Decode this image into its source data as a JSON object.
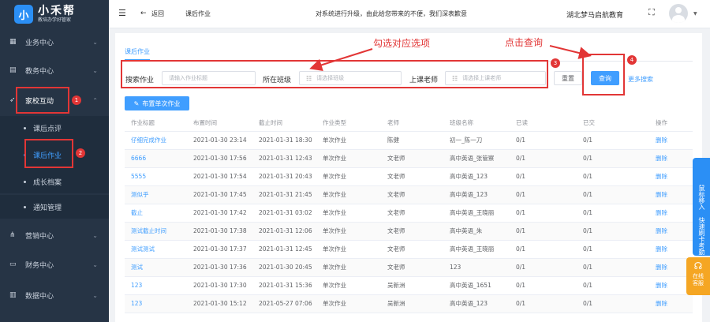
{
  "sidebar": {
    "logo_glyph": "小",
    "logo_name": "小禾帮",
    "logo_sub": "教培办学好管家",
    "menus": [
      {
        "label": "业务中心",
        "icon": "grid-icon"
      },
      {
        "label": "教务中心",
        "icon": "book-icon"
      },
      {
        "label": "家校互动",
        "icon": "send-icon"
      },
      {
        "label": "营销中心",
        "icon": "share-icon"
      },
      {
        "label": "财务中心",
        "icon": "wallet-icon"
      },
      {
        "label": "数据中心",
        "icon": "chart-icon"
      }
    ],
    "sub_items": [
      "课后点评",
      "课后作业",
      "成长档案",
      "通知管理"
    ]
  },
  "topbar": {
    "back": "返回",
    "page": "课后作业",
    "notice": "对系统进行升级，由此给您带来的不便，我们深表歉意",
    "org": "湖北梦马启航教育"
  },
  "tabs": {
    "active": "课后作业"
  },
  "filters": {
    "homework_label": "搜索作业",
    "homework_placeholder": "请输入作业标题",
    "class_label": "所在班级",
    "class_placeholder": "请选择班级",
    "teacher_label": "上课老师",
    "teacher_placeholder": "请选择上课老师",
    "reset": "重置",
    "search": "查询",
    "more": "更多搜索"
  },
  "toolbar": {
    "assign": "布置单次作业"
  },
  "annotations": {
    "a1": "勾选对应选项",
    "a2": "点击查询",
    "n1": "1",
    "n2": "2",
    "n3": "3",
    "n4": "4"
  },
  "table": {
    "headers": [
      "作业标题",
      "布置时间",
      "截止时间",
      "作业类型",
      "老师",
      "班级名称",
      "已读",
      "已交",
      "操作"
    ],
    "rows": [
      [
        "仔细完成作业",
        "2021-01-30 23:14",
        "2021-01-31 18:30",
        "单次作业",
        "陈健",
        "初一_陈一刀",
        "0/1",
        "0/1",
        "删除"
      ],
      [
        "6666",
        "2021-01-30 17:56",
        "2021-01-31 12:43",
        "单次作业",
        "文老师",
        "高中英语_张管察",
        "0/1",
        "0/1",
        "删除"
      ],
      [
        "5555",
        "2021-01-30 17:54",
        "2021-01-31 20:43",
        "单次作业",
        "文老师",
        "高中英语_123",
        "0/1",
        "0/1",
        "删除"
      ],
      [
        "测似乎",
        "2021-01-30 17:45",
        "2021-01-31 21:45",
        "单次作业",
        "文老师",
        "高中英语_123",
        "0/1",
        "0/1",
        "删除"
      ],
      [
        "截止",
        "2021-01-30 17:42",
        "2021-01-31 03:02",
        "单次作业",
        "文老师",
        "高中英语_王晓丽",
        "0/1",
        "0/1",
        "删除"
      ],
      [
        "测试截止时间",
        "2021-01-30 17:38",
        "2021-01-31 12:06",
        "单次作业",
        "文老师",
        "高中英语_朱",
        "0/1",
        "0/1",
        "删除"
      ],
      [
        "测试测试",
        "2021-01-30 17:37",
        "2021-01-31 12:45",
        "单次作业",
        "文老师",
        "高中英语_王晓丽",
        "0/1",
        "0/1",
        "删除"
      ],
      [
        "测试",
        "2021-01-30 17:36",
        "2021-01-30 20:45",
        "单次作业",
        "文老师",
        "123",
        "0/1",
        "0/1",
        "删除"
      ],
      [
        "123",
        "2021-01-30 17:30",
        "2021-01-31 15:36",
        "单次作业",
        "吴新洲",
        "高中英语_1651",
        "0/1",
        "0/1",
        "删除"
      ],
      [
        "123",
        "2021-01-30 15:12",
        "2021-05-27 07:06",
        "单次作业",
        "吴新洲",
        "高中英语_123",
        "0/1",
        "0/1",
        "删除"
      ]
    ]
  },
  "side_tools": {
    "mouse_text": "鼠标移入",
    "fast_text": "快速刷卡考勤",
    "service": "在线客服"
  }
}
